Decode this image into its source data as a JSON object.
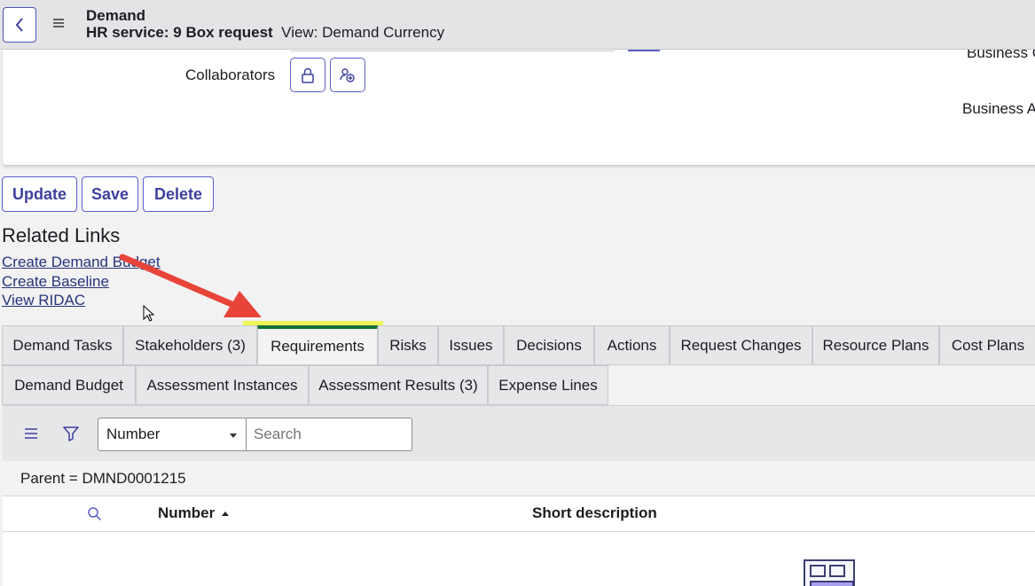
{
  "header": {
    "title": "Demand",
    "record": "HR service: 9 Box request",
    "view": "View: Demand Currency"
  },
  "form": {
    "collaborators_label": "Collaborators",
    "right_label_1": "Business C",
    "right_label_2": "Business A"
  },
  "actions": {
    "update": "Update",
    "save": "Save",
    "delete": "Delete"
  },
  "related_links": {
    "title": "Related Links",
    "links": [
      "Create Demand Budget",
      "Create Baseline",
      "View RIDAC"
    ]
  },
  "tabs_row1": [
    "Demand Tasks",
    "Stakeholders (3)",
    "Requirements",
    "Risks",
    "Issues",
    "Decisions",
    "Actions",
    "Request Changes",
    "Resource Plans",
    "Cost Plans"
  ],
  "tabs_row2": [
    "Demand Budget",
    "Assessment Instances",
    "Assessment Results (3)",
    "Expense Lines"
  ],
  "active_tab": "Requirements",
  "list": {
    "select_value": "Number",
    "search_placeholder": "Search",
    "breadcrumb": "Parent = DMND0001215",
    "columns": [
      "Number",
      "Short description"
    ]
  },
  "colors": {
    "accent": "#5b5fc7",
    "active_tab_indicator": "#107133",
    "highlight": "#eef63c",
    "annotation_arrow": "#e8443a"
  }
}
